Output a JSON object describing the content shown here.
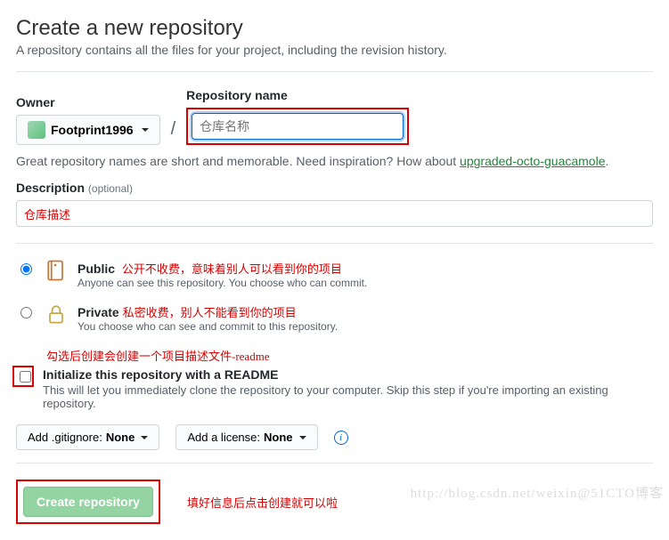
{
  "header": {
    "title": "Create a new repository",
    "subtitle": "A repository contains all the files for your project, including the revision history."
  },
  "owner": {
    "label": "Owner",
    "name": "Footprint1996"
  },
  "repo": {
    "label": "Repository name",
    "placeholder_anno": "仓库名称"
  },
  "name_hint": {
    "pre": "Great repository names are short and memorable. Need inspiration? How about ",
    "suggestion": "upgraded-octo-guacamole",
    "post": "."
  },
  "description": {
    "label": "Description",
    "optional": "(optional)",
    "value_anno": "仓库描述"
  },
  "visibility": {
    "public": {
      "title": "Public",
      "anno": "公开不收费，意味着别人可以看到你的项目",
      "sub": "Anyone can see this repository. You choose who can commit."
    },
    "private": {
      "title": "Private",
      "anno": "私密收费，别人不能看到你的项目",
      "sub": "You choose who can see and commit to this repository."
    }
  },
  "readme": {
    "anno": "勾选后创建会创建一个项目描述文件-readme",
    "title": "Initialize this repository with a README",
    "sub": "This will let you immediately clone the repository to your computer. Skip this step if you're importing an existing repository."
  },
  "buttons": {
    "gitignore_pre": "Add .gitignore: ",
    "gitignore_val": "None",
    "license_pre": "Add a license: ",
    "license_val": "None",
    "create": "Create repository",
    "create_anno": "填好信息后点击创建就可以啦"
  },
  "watermark": "http://blog.csdn.net/weixin@51CTO博客"
}
